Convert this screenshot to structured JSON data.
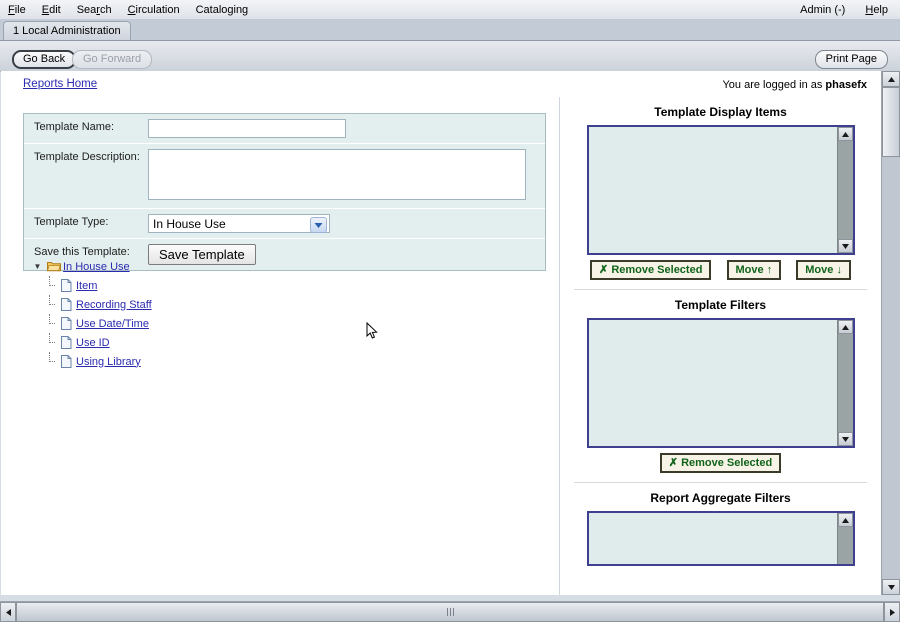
{
  "window": {
    "menu": [
      {
        "label": "File",
        "accel": "F"
      },
      {
        "label": "Edit",
        "accel": "E"
      },
      {
        "label": "Search",
        "accel": "r"
      },
      {
        "label": "Circulation",
        "accel": "C"
      },
      {
        "label": "Cataloging",
        "accel": "g"
      }
    ],
    "menu_right": [
      {
        "label": "Admin (-)"
      },
      {
        "label": "Help"
      }
    ],
    "tabs": [
      {
        "label": "1 Local Administration",
        "active": true
      }
    ]
  },
  "toolbar": {
    "go_back": "Go Back",
    "go_forward": "Go Forward",
    "print_page": "Print Page"
  },
  "header": {
    "breadcrumb": "Reports Home",
    "login_prefix": "You are logged in as ",
    "login_user": "phasefx"
  },
  "form": {
    "name_label": "Template Name:",
    "name_value": "",
    "name_placeholder": "",
    "description_label": "Template Description:",
    "description_value": "",
    "description_placeholder": "",
    "type_label": "Template Type:",
    "type_value": "In House Use",
    "type_options": [
      "In House Use"
    ],
    "save_label": "Save this Template:",
    "save_button": "Save Template"
  },
  "tree": {
    "root": {
      "label": "In House Use",
      "expanded": true,
      "twisty": "▼"
    },
    "children": [
      {
        "label": "Item"
      },
      {
        "label": "Recording Staff"
      },
      {
        "label": "Use Date/Time"
      },
      {
        "label": "Use ID"
      },
      {
        "label": "Using Library"
      }
    ]
  },
  "panels": {
    "display_items": {
      "title": "Template Display Items",
      "items": [],
      "buttons": [
        {
          "label": "Remove Selected",
          "mark": "✗"
        },
        {
          "label": "Move",
          "mark": "↑"
        },
        {
          "label": "Move",
          "mark": "↓"
        }
      ]
    },
    "template_filters": {
      "title": "Template Filters",
      "items": [],
      "buttons": [
        {
          "label": "Remove Selected",
          "mark": "✗"
        }
      ]
    },
    "aggregate_filters": {
      "title": "Report Aggregate Filters",
      "items": []
    }
  },
  "colors": {
    "panel_bg": "#e3eeee",
    "listbox_bg": "#e0ecec",
    "listbox_border": "#3f3f8f",
    "link": "#2b2bb0",
    "button_text": "#10631a",
    "button_bg": "#f7f4e7",
    "chrome": "#c9cfd7"
  }
}
